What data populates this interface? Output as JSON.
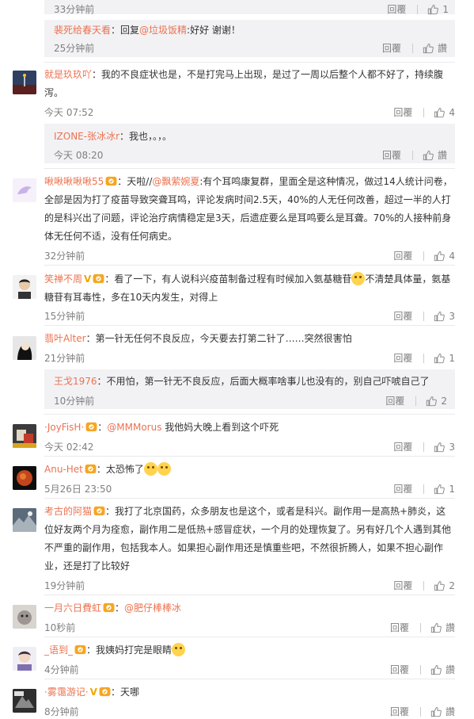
{
  "ui": {
    "reply": "回覆",
    "zan": "讚",
    "separator_colon": "："
  },
  "c0": {
    "time": "33分钟前",
    "likes": "1"
  },
  "c1": {
    "user": "裴死给春天看",
    "prefix": "：回复",
    "mention": "@垃圾饭精",
    "text": ":好好 谢谢！",
    "time": "25分钟前"
  },
  "c2": {
    "user": "就是玖玖吖",
    "text": "：我的不良症状也是，不是打完马上出现，是过了一周以后整个人都不好了，持续腹泻。",
    "time": "今天 07:52",
    "likes": "4"
  },
  "c3": {
    "user": "IZONE-张冰冰r",
    "text": "：我也，。，。",
    "time": "今天 08:20"
  },
  "c4": {
    "user": "啾啾啾啾啾55",
    "prefix": "：天啦//",
    "mention": "@飘萦婉夏",
    "text": ":有个耳鸣康复群，里面全是这种情况，做过14人统计问卷，全部是因为打了疫苗导致突聋耳鸣，评论发病时间2.5天，40%的人无任何改善，超过一半的人打的是科兴出了问题，评论治疗病情稳定是3天，后遗症要么是耳鸣要么是耳聋。70%的人接种前身体无任何不适，没有任何病史。",
    "time": "32分钟前",
    "likes": "4"
  },
  "c5": {
    "user": "笑禅不周",
    "text": "：看了一下，有人说科兴疫苗制备过程有时候加入氨基糖苷",
    "text2": "不清楚具体量，氨基糖苷有耳毒性，多在10天内发生，对得上",
    "time": "15分钟前",
    "likes": "3"
  },
  "c6": {
    "user": "翡叶Alter",
    "text": "：第一针无任何不良反应，今天要去打第二针了……突然很害怕",
    "time": "21分钟前",
    "likes": "1"
  },
  "c7": {
    "user": "王戈1976",
    "text": "：不用怕，第一针无不良反应，后面大概率啥事儿也没有的，别自己吓唬自己了",
    "time": "10分钟前",
    "likes": "2"
  },
  "c8": {
    "user": "·JoyFisH·",
    "mention": "@MMMorus",
    "text": " 我他妈大晚上看到这个吓死",
    "time": "今天 02:42",
    "likes": "3"
  },
  "c9": {
    "user": "Anu-Het",
    "text": "：太恐怖了",
    "time": "5月26日 23:50",
    "likes": "1"
  },
  "c10": {
    "user": "考古的阿猫",
    "text": "：我打了北京国药，众多朋友也是这个，或者是科兴。副作用一是高热+肺炎，这位好友两个月为痊愈，副作用二是低热+感冒症状，一个月的处理恢复了。另有好几个人遇到其他不严重的副作用，包括我本人。如果担心副作用还是慎重些吧，不然很折腾人，如果不担心副作业，还是打了比较好",
    "time": "19分钟前",
    "likes": "2"
  },
  "c11": {
    "user": "一月六日費虹",
    "mention": "@肥仔棒棒冰",
    "time": "10秒前"
  },
  "c12": {
    "user": "_语到_",
    "text": "：我姨妈打完是眼睛",
    "time": "4分钟前"
  },
  "c13": {
    "user": "·雾霭游记·",
    "text": "：天哪",
    "time": "8分钟前"
  }
}
